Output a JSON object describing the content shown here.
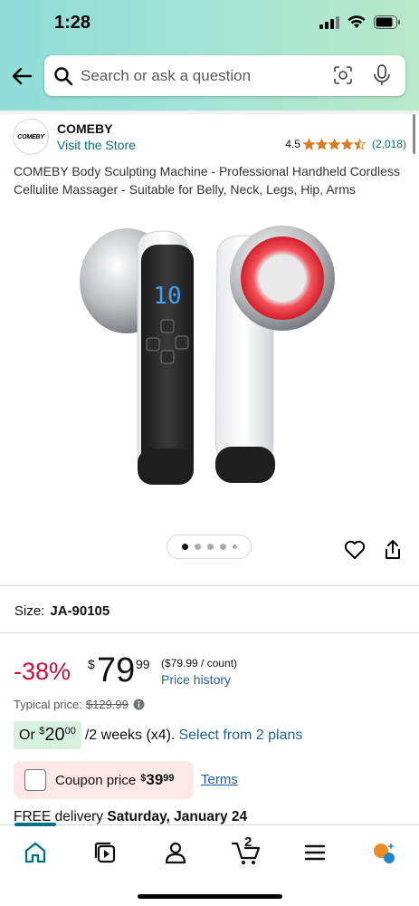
{
  "status_bar": {
    "time": "1:28"
  },
  "search": {
    "placeholder": "Search or ask a question"
  },
  "brand": {
    "logo_text": "COMEBY",
    "name": "COMEBY",
    "visit_store": "Visit the Store",
    "rating_value": "4.5",
    "rating_stars": 4.5,
    "rating_count": "(2,018)"
  },
  "product": {
    "title": "COMEBY Body Sculpting Machine - Professional Handheld Cordless Cellulite Massager - Suitable for Belly, Neck, Legs, Hip, Arms",
    "display_digits": "10",
    "image_dots": 5,
    "active_dot": 0
  },
  "size": {
    "label": "Size:",
    "value": "JA-90105"
  },
  "pricing": {
    "discount": "-38%",
    "currency": "$",
    "whole": "79",
    "fraction": "99",
    "per_count": "($79.99 / count)",
    "price_history": "Price history",
    "typical_label": "Typical price:",
    "typical_value": "$129.99",
    "install_prefix": "Or",
    "install_currency": "$",
    "install_whole": "20",
    "install_fraction": "00",
    "install_suffix": "/2 weeks (x4).",
    "install_link": "Select from 2 plans"
  },
  "coupon": {
    "label": "Coupon price",
    "currency": "$",
    "whole": "39",
    "fraction": "99",
    "terms": "Terms"
  },
  "delivery": {
    "prefix": "FREE delivery",
    "date": "Saturday, January 24"
  },
  "bottom_nav": {
    "cart_count": "2",
    "items": [
      "home-icon",
      "video-icon",
      "account-icon",
      "cart-icon",
      "menu-icon",
      "rufus-icon"
    ]
  },
  "colors": {
    "header_gradient_start": "#8fdcd8",
    "header_gradient_end": "#b9e9c9",
    "discount_red": "#cc0c39",
    "link_blue": "#2162a1",
    "star_orange": "#de7921",
    "teal": "#007185",
    "coupon_bg": "#fde7e7",
    "install_badge_bg": "#d8f1de"
  }
}
